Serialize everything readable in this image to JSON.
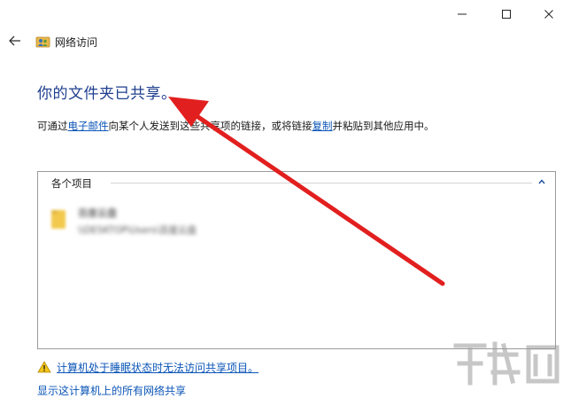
{
  "window": {
    "minimize_glyph": "—",
    "maximize_glyph": "☐",
    "close_glyph": "✕"
  },
  "nav": {
    "back_icon": "back-arrow-icon",
    "app_icon": "network-share-icon",
    "title": "网络访问"
  },
  "main": {
    "heading": "你的文件夹已共享。",
    "description": {
      "part1": "可通过",
      "link1": "电子邮件",
      "part2": "向某个人发送到这些共享项的链接，或将链接",
      "link2": "复制",
      "part3": "并粘贴到其他应用中。"
    }
  },
  "items_box": {
    "title": "各个项目",
    "collapse_icon": "chevron-up-icon",
    "items": [
      {
        "icon": "folder-icon",
        "name": "百度云盘",
        "path": "\\\\DESKTOP\\Users\\百度云盘"
      }
    ]
  },
  "footer": {
    "warning_icon": "warning-icon",
    "warning_link": "计算机处于睡眠状态时无法访问共享项目。",
    "second_link": "显示这计算机上的所有网络共享"
  },
  "colors": {
    "heading": "#1f3f8f",
    "link": "#0b55b7",
    "arrow": "#e21f1f"
  }
}
